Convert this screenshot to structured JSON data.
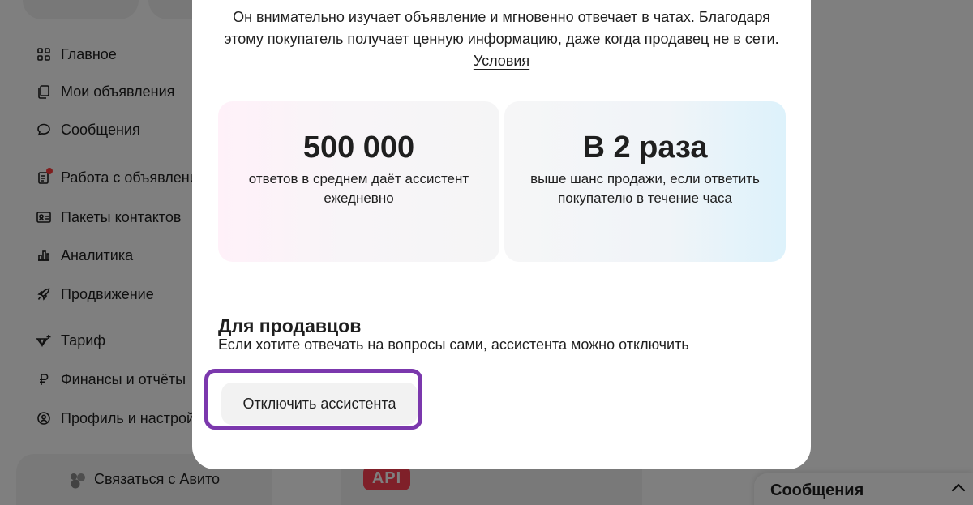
{
  "sidebar": {
    "items": [
      {
        "label": "Главное",
        "icon": "grid-icon"
      },
      {
        "label": "Мои объявления",
        "icon": "documents-icon"
      },
      {
        "label": "Сообщения",
        "icon": "chat-icon"
      },
      {
        "label": "Работа с объявлениями",
        "icon": "listing-work-icon",
        "has_notification": true
      },
      {
        "label": "Пакеты контактов",
        "icon": "contact-card-icon"
      },
      {
        "label": "Аналитика",
        "icon": "analytics-icon"
      },
      {
        "label": "Продвижение",
        "icon": "rocket-icon"
      },
      {
        "label": "Тариф",
        "icon": "tariff-icon"
      },
      {
        "label": "Финансы и отчёты",
        "icon": "ruble-icon"
      },
      {
        "label": "Профиль и настройки",
        "icon": "profile-icon"
      }
    ]
  },
  "contact_button": {
    "label": "Связаться с Авито",
    "icon": "avito-bubbles-icon"
  },
  "background": {
    "api_badge": "API"
  },
  "messages_panel": {
    "title": "Сообщения",
    "icon": "chevron-up-icon"
  },
  "modal": {
    "intro": {
      "text": "Он внимательно изучает объявление и мгновенно отвечает в чатах. Благодаря этому покупатель получает ценную информацию, даже когда продавец не в сети.",
      "link": "Условия"
    },
    "stats": [
      {
        "value": "500 000",
        "description": "ответов в среднем даёт ассистент ежедневно"
      },
      {
        "value": "В 2 раза",
        "description": "выше шанс продажи, если ответить покупателю в течение часа"
      }
    ],
    "sellers": {
      "title": "Для продавцов",
      "text": "Если хотите отвечать на вопросы сами, ассистента можно отключить",
      "button": "Отключить ассистента"
    }
  },
  "colors": {
    "highlight": "#7b38ad",
    "badge": "#ff4053",
    "notification": "#ff3b3b",
    "button": "#f2f2f2"
  }
}
